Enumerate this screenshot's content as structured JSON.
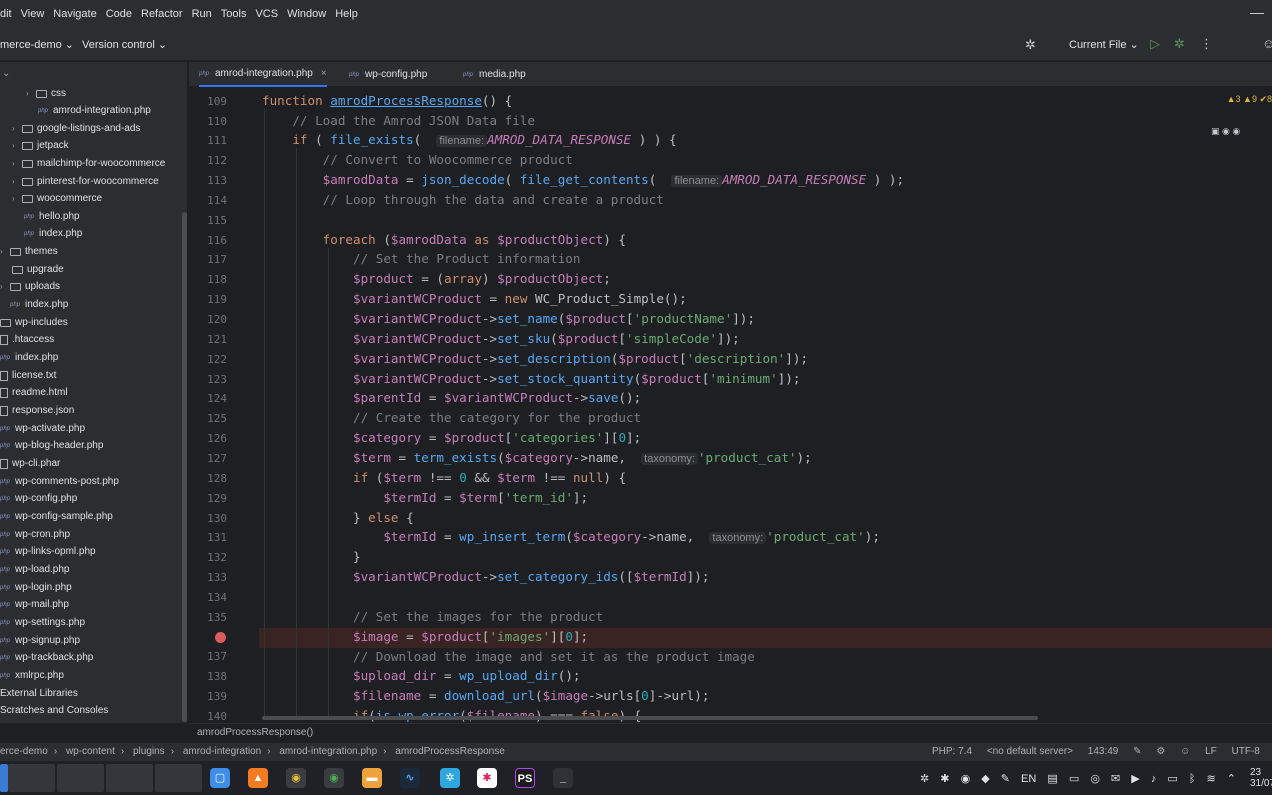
{
  "menubar": {
    "items": [
      "dit",
      "View",
      "Navigate",
      "Code",
      "Refactor",
      "Run",
      "Tools",
      "VCS",
      "Window",
      "Help"
    ]
  },
  "toolbar": {
    "project": "merce-demo ⌄",
    "version_control": "Version control ⌄",
    "run_config": "Current File ⌄"
  },
  "tree": {
    "items": [
      {
        "label": "css",
        "type": "folder"
      },
      {
        "label": "amrod-integration.php",
        "type": "php"
      },
      {
        "label": "google-listings-and-ads",
        "type": "folder"
      },
      {
        "label": "jetpack",
        "type": "folder"
      },
      {
        "label": "mailchimp-for-woocommerce",
        "type": "folder"
      },
      {
        "label": "pinterest-for-woocommerce",
        "type": "folder"
      },
      {
        "label": "woocommerce",
        "type": "folder"
      },
      {
        "label": "hello.php",
        "type": "php"
      },
      {
        "label": "index.php",
        "type": "php"
      },
      {
        "label": "themes",
        "type": "folder"
      },
      {
        "label": "upgrade",
        "type": "folder"
      },
      {
        "label": "uploads",
        "type": "folder"
      },
      {
        "label": "index.php",
        "type": "php"
      },
      {
        "label": "wp-includes",
        "type": "folder"
      },
      {
        "label": ".htaccess",
        "type": "file"
      },
      {
        "label": "index.php",
        "type": "php"
      },
      {
        "label": "license.txt",
        "type": "file"
      },
      {
        "label": "readme.html",
        "type": "file"
      },
      {
        "label": "response.json",
        "type": "file"
      },
      {
        "label": "wp-activate.php",
        "type": "php"
      },
      {
        "label": "wp-blog-header.php",
        "type": "php"
      },
      {
        "label": "wp-cli.phar",
        "type": "file"
      },
      {
        "label": "wp-comments-post.php",
        "type": "php"
      },
      {
        "label": "wp-config.php",
        "type": "php"
      },
      {
        "label": "wp-config-sample.php",
        "type": "php"
      },
      {
        "label": "wp-cron.php",
        "type": "php"
      },
      {
        "label": "wp-links-opml.php",
        "type": "php"
      },
      {
        "label": "wp-load.php",
        "type": "php"
      },
      {
        "label": "wp-login.php",
        "type": "php"
      },
      {
        "label": "wp-mail.php",
        "type": "php"
      },
      {
        "label": "wp-settings.php",
        "type": "php"
      },
      {
        "label": "wp-signup.php",
        "type": "php"
      },
      {
        "label": "wp-trackback.php",
        "type": "php"
      },
      {
        "label": "xmlrpc.php",
        "type": "php"
      },
      {
        "label": "External Libraries",
        "type": "lib"
      },
      {
        "label": "Scratches and Consoles",
        "type": "lib"
      }
    ]
  },
  "tabs": [
    {
      "label": "amrod-integration.php",
      "active": true
    },
    {
      "label": "wp-config.php",
      "active": false
    },
    {
      "label": "media.php",
      "active": false
    }
  ],
  "editor": {
    "line_numbers": [
      "109",
      "110",
      "111",
      "112",
      "113",
      "114",
      "115",
      "116",
      "117",
      "118",
      "119",
      "120",
      "121",
      "122",
      "123",
      "124",
      "125",
      "126",
      "127",
      "128",
      "129",
      "130",
      "131",
      "132",
      "133",
      "134",
      "135",
      "136",
      "137",
      "138",
      "139",
      "140"
    ],
    "breakpoint_line": "136",
    "inspections": "▲3 ▲9 ✔8",
    "hints": {
      "filename": "filename:",
      "taxonomy": "taxonomy:"
    }
  },
  "breadcrumb_editor": "amrodProcessResponse()",
  "status": {
    "crumbs": [
      "erce-demo",
      "wp-content",
      "plugins",
      "amrod-integration",
      "amrod-integration.php",
      "amrodProcessResponse"
    ],
    "php": "PHP: 7.4",
    "server": "<no default server>",
    "position": "143:49",
    "line_sep": "LF",
    "encoding": "UTF-8",
    "indent": "4"
  },
  "taskbar": {
    "lang": "EN",
    "clock_time": "23",
    "clock_date": "31/07"
  }
}
